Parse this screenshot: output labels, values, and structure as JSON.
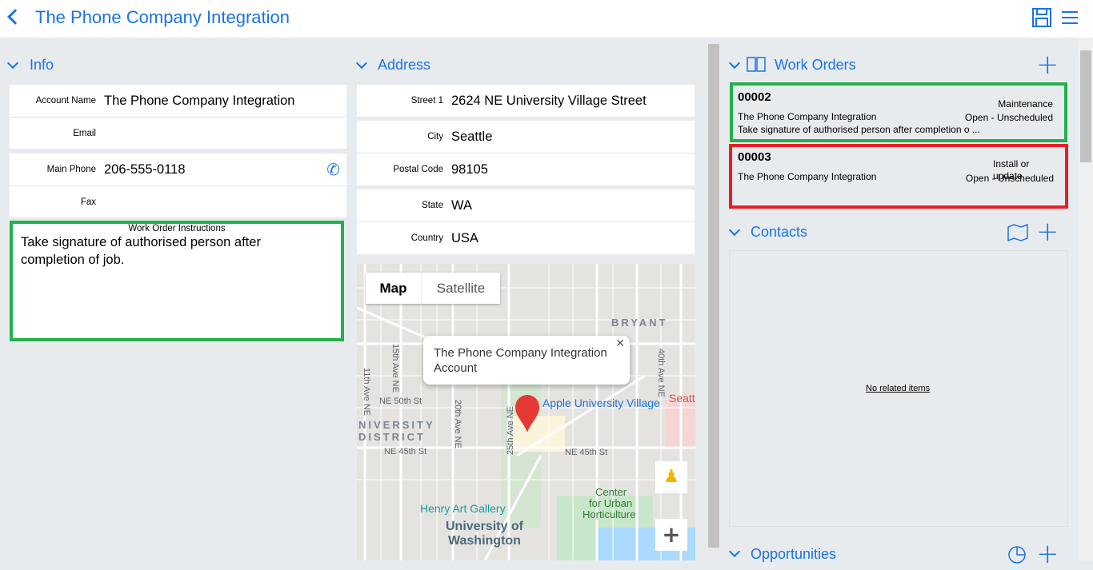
{
  "header": {
    "title": "The Phone Company Integration"
  },
  "info": {
    "title": "Info",
    "fields": [
      {
        "label": "Account Name",
        "value": "The Phone Company Integration"
      },
      {
        "label": "Email",
        "value": ""
      },
      {
        "label": "Main Phone",
        "value": "206-555-0118"
      },
      {
        "label": "Fax",
        "value": ""
      }
    ],
    "instructions_label": "Work Order Instructions",
    "instructions": "Take signature of authorised person after completion of job."
  },
  "address": {
    "title": "Address",
    "fields": [
      {
        "label": "Street 1",
        "value": "2624 NE University Village Street"
      },
      {
        "label": "City",
        "value": "Seattle"
      },
      {
        "label": "Postal Code",
        "value": "98105"
      },
      {
        "label": "State",
        "value": "WA"
      },
      {
        "label": "Country",
        "value": "USA"
      }
    ]
  },
  "map": {
    "map_tab": "Map",
    "satellite_tab": "Satellite",
    "popup": "The Phone Company Integration Account",
    "labels": [
      "BRYANT",
      "NE 50th St",
      "NIVERSITY",
      "DISTRICT",
      "NE 45th St",
      "NE 45th St",
      "Apple University Village",
      "Henry Art Gallery",
      "University of",
      "Washington",
      "Center",
      "for Urban",
      "Horticulture",
      "15th Ave NE",
      "20th Ave NE",
      "25th Ave NE",
      "11th Ave NE",
      "40th Ave NE",
      "Seatt"
    ],
    "zoom_in": "+"
  },
  "work_orders": {
    "title": "Work Orders",
    "items": [
      {
        "number": "00002",
        "account": "The Phone Company Integration",
        "type": "Maintenance",
        "status": "Open - Unscheduled",
        "desc": "Take signature of authorised person after completion o ..."
      },
      {
        "number": "00003",
        "account": "The Phone Company Integration",
        "type": "Install or update",
        "status": "Open - Unscheduled",
        "desc": ""
      }
    ]
  },
  "contacts": {
    "title": "Contacts",
    "empty": "No related items"
  },
  "opportunities": {
    "title": "Opportunities"
  },
  "colors": {
    "accent": "#1a73e8",
    "highlight_green": "#22b14c",
    "highlight_red": "#ed1c24"
  }
}
